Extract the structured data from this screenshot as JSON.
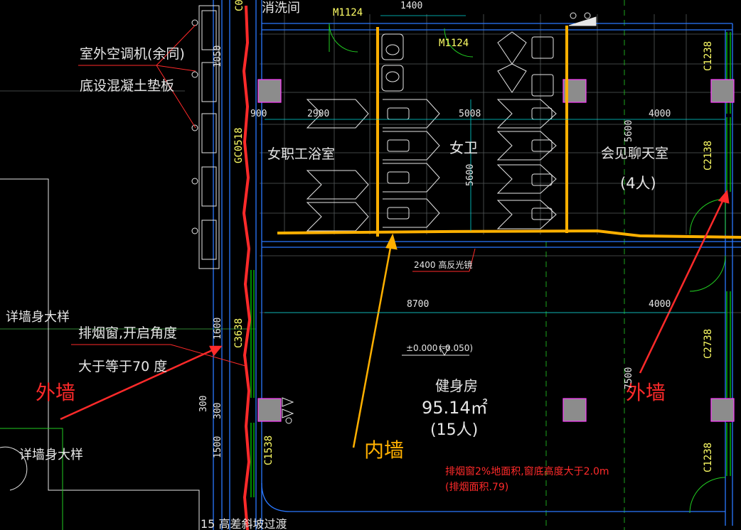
{
  "colors": {
    "background": "#000000",
    "grid": "#9aa3a8",
    "wall_outline": "#2a78ff",
    "annotation_red": "#ff2a2a",
    "inner_wall_yellow": "#ffb000",
    "column_fill": "#8c8c8c",
    "column_edge": "#ff3cff",
    "window_green": "#00d000",
    "text_white": "#e6e6e6",
    "axis_green": "#22cc22"
  },
  "labels": {
    "outdoor_ac": "室外空调机(余同)",
    "ac_base": "底设混凝土垫板",
    "wall_detail_1": "详墙身大样",
    "wall_detail_2": "详墙身大样",
    "exhaust_window_1": "排烟窗,开启角度",
    "exhaust_window_2": "大于等于70 度",
    "outer_wall_left": "外墙",
    "outer_wall_right": "外墙",
    "inner_wall": "内墙",
    "top_room": "消洗间",
    "female_bath": "女职工浴室",
    "female_wc": "女卫",
    "meeting_room": "会见聊天室",
    "meeting_capacity": "(4人)",
    "gym": "健身房",
    "gym_area": "95.14㎡",
    "gym_capacity": "(15人)",
    "mirror_note": "2400 高反光镜",
    "level_mark": "±0.000",
    "level_mark_2": "(-0.050)",
    "smoke_note_1": "排烟窗2%地面积,窗底高度大于2.0m",
    "smoke_note_2": "(排烟面积.79)",
    "slope_note": "15 高差斜坡过渡"
  },
  "tags": {
    "door_1": "M1124",
    "door_2": "M1124",
    "win_top_left": "C0",
    "win_gc": "GC0518",
    "win_c3638": "C3638",
    "win_c1538": "C1538",
    "win_c1238_a": "C1238",
    "win_c2138": "C2138",
    "win_c2738": "C2738",
    "win_c1238_b": "C1238"
  },
  "dimensions": {
    "d1400": "1400",
    "d2900": "2900",
    "d5008": "5008",
    "d4000_a": "4000",
    "d5600": "5600",
    "d5600_b": "5600",
    "d900": "900",
    "d8700": "8700",
    "d4000_b": "4000",
    "d7500": "7500",
    "d1600": "1600",
    "d300": "300",
    "d300_b": "300",
    "d1500": "1500",
    "d1050": "1050"
  }
}
